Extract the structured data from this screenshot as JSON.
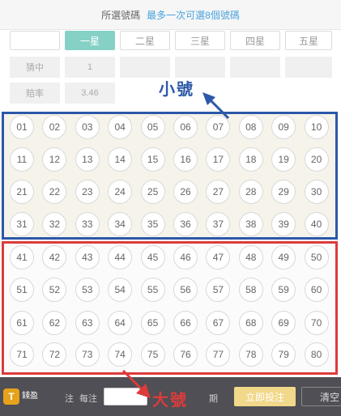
{
  "header": {
    "title": "所選號碼",
    "hint": "最多一次可選8個號碼"
  },
  "tabs": [
    "",
    "一星",
    "二星",
    "三星",
    "四星",
    "五星"
  ],
  "active_tab": 1,
  "info": {
    "hit_label": "猜中",
    "hit_value": "1",
    "odds_label": "賠率",
    "odds_value": "3.46"
  },
  "numbers_small": [
    "01",
    "02",
    "03",
    "04",
    "05",
    "06",
    "07",
    "08",
    "09",
    "10",
    "11",
    "12",
    "13",
    "14",
    "15",
    "16",
    "17",
    "18",
    "19",
    "20",
    "21",
    "22",
    "23",
    "24",
    "25",
    "26",
    "27",
    "28",
    "29",
    "30",
    "31",
    "32",
    "33",
    "34",
    "35",
    "36",
    "37",
    "38",
    "39",
    "40"
  ],
  "numbers_big": [
    "41",
    "42",
    "43",
    "44",
    "45",
    "46",
    "47",
    "48",
    "49",
    "50",
    "51",
    "52",
    "53",
    "54",
    "55",
    "56",
    "57",
    "58",
    "59",
    "60",
    "61",
    "62",
    "63",
    "64",
    "65",
    "66",
    "67",
    "68",
    "69",
    "70",
    "71",
    "72",
    "73",
    "74",
    "75",
    "76",
    "77",
    "78",
    "79",
    "80"
  ],
  "annotations": {
    "small_label": "小號",
    "big_label": "大號",
    "small_color": "#2c58a8",
    "big_color": "#dd3b3b"
  },
  "footer": {
    "logo_mark": "T",
    "logo_text": "錢盈",
    "bet_label": "注",
    "per_bet_label": "每注",
    "bet_amount": "",
    "period_label": "期",
    "submit_label": "立即投注",
    "clear_label": "清空"
  }
}
